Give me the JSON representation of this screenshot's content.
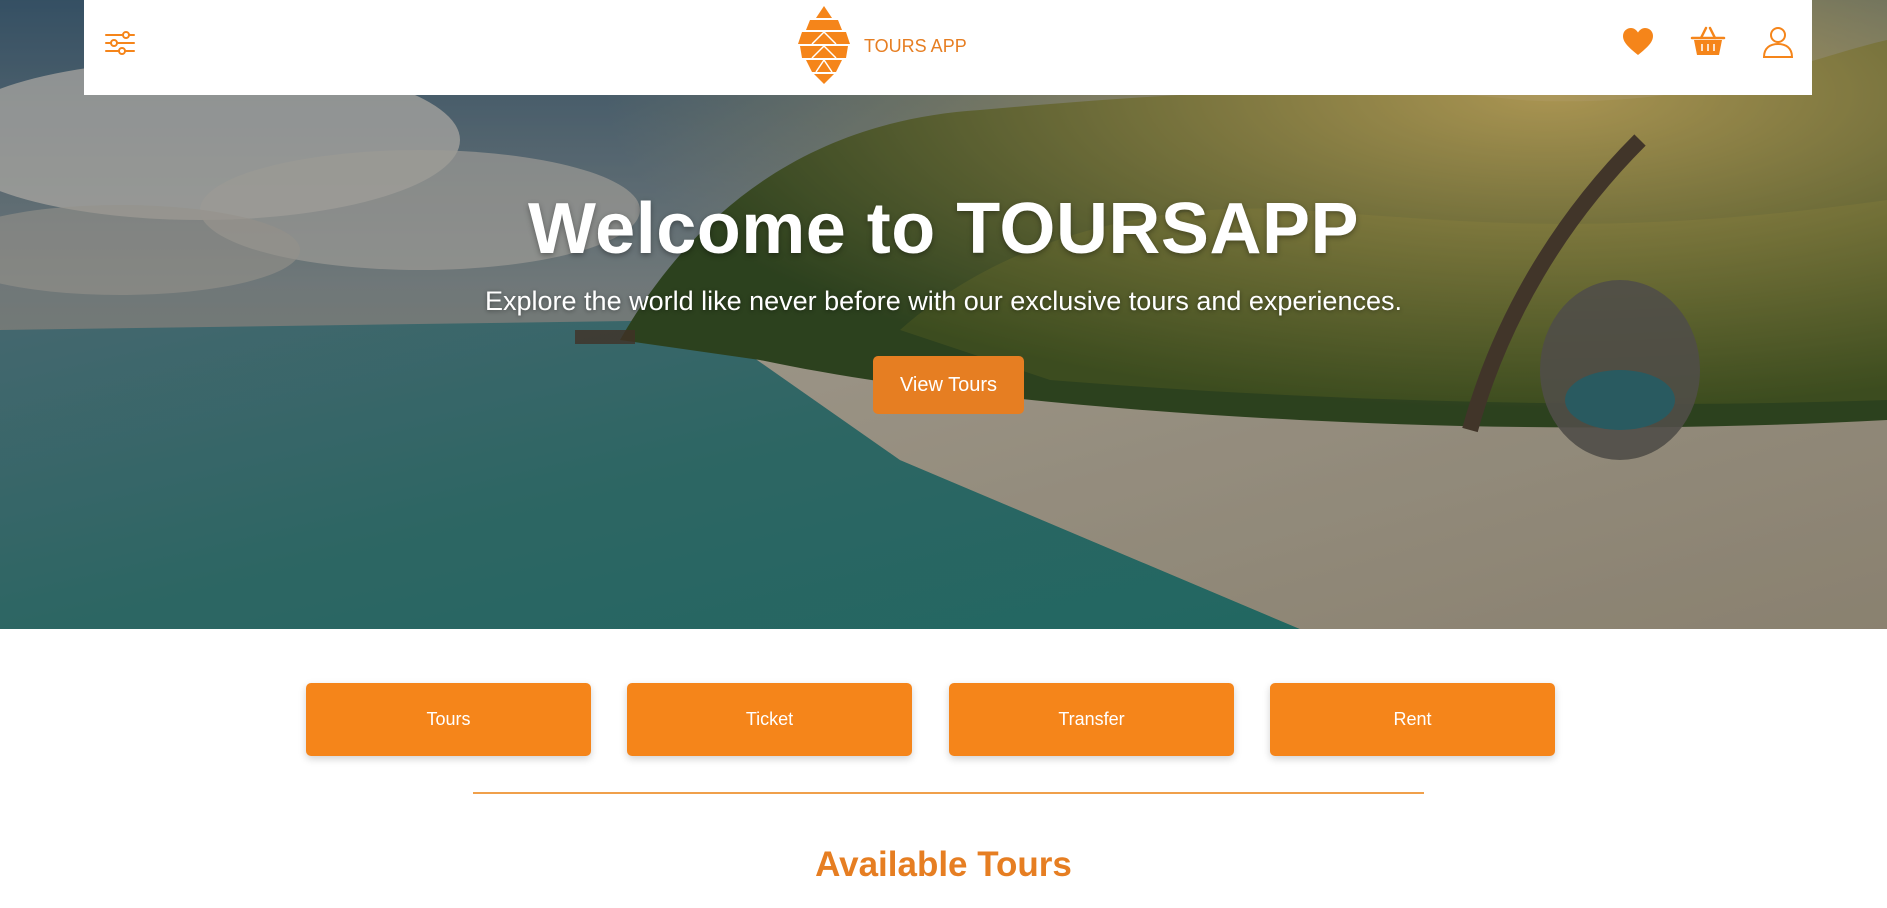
{
  "header": {
    "brand": "TOURS APP",
    "menu_icon": "sliders-icon",
    "icons": [
      "heart-icon",
      "basket-icon",
      "user-icon"
    ]
  },
  "hero": {
    "title": "Welcome to TOURSAPP",
    "subtitle": "Explore the world like never before with our exclusive tours and experiences.",
    "button_label": "View Tours"
  },
  "categories": {
    "items": [
      {
        "label": "Tours"
      },
      {
        "label": "Ticket"
      },
      {
        "label": "Transfer"
      },
      {
        "label": "Rent"
      }
    ]
  },
  "sections": {
    "available_title": "Available Tours"
  },
  "colors": {
    "accent": "#f5851a",
    "accent_dark": "#e67e22",
    "white": "#ffffff"
  }
}
